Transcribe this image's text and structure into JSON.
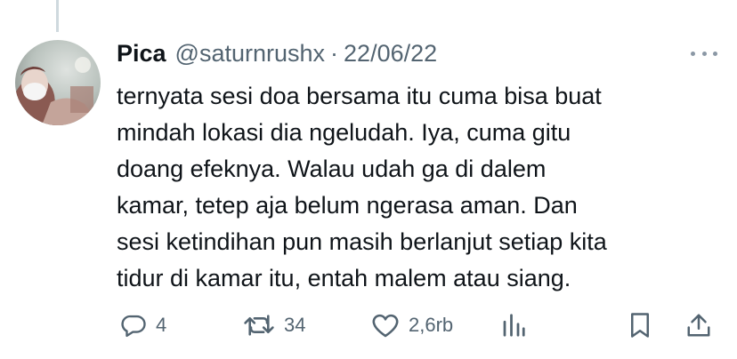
{
  "tweet": {
    "author_name": "Pica",
    "handle": "@saturnrushx",
    "separator": "·",
    "date": "22/06/22",
    "text_lines": [
      "ternyata sesi doa bersama itu cuma bisa buat",
      "mindah lokasi dia ngeludah. Iya, cuma gitu",
      "doang efeknya. Walau udah ga di dalem",
      "kamar, tetep aja belum ngerasa aman. Dan",
      "sesi ketindihan pun masih berlanjut setiap kita",
      "tidur di kamar itu, entah malem atau siang."
    ]
  },
  "actions": {
    "reply_count": "4",
    "retweet_count": "34",
    "like_count": "2,6rb"
  },
  "icons": {
    "more": "more-dots-icon",
    "reply": "reply-bubble-icon",
    "retweet": "retweet-arrows-icon",
    "like": "heart-icon",
    "views": "bar-chart-icon",
    "bookmark": "bookmark-icon",
    "share": "share-upload-icon"
  },
  "colors": {
    "text": "#0f1419",
    "secondary": "#536471",
    "thread_line": "#cfd9de"
  }
}
